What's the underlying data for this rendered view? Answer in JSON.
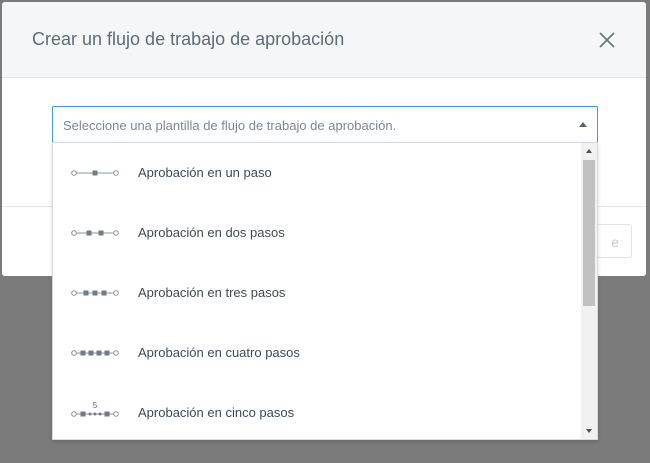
{
  "dialog": {
    "title": "Crear un flujo de trabajo de aprobación",
    "footer_button_partial": "e"
  },
  "select": {
    "placeholder": "Seleccione una plantilla de flujo de trabajo de aprobación."
  },
  "options": [
    {
      "label": "Aprobación en un paso",
      "steps": 1
    },
    {
      "label": "Aprobación en dos pasos",
      "steps": 2
    },
    {
      "label": "Aprobación en tres pasos",
      "steps": 3
    },
    {
      "label": "Aprobación en cuatro pasos",
      "steps": 4
    },
    {
      "label": "Aprobación en cinco pasos",
      "steps": 5,
      "icon_number": "5"
    }
  ],
  "colors": {
    "accent_border": "#3d9cd2",
    "overlay": "#7b7b7b",
    "icon": "#7f8a96"
  }
}
